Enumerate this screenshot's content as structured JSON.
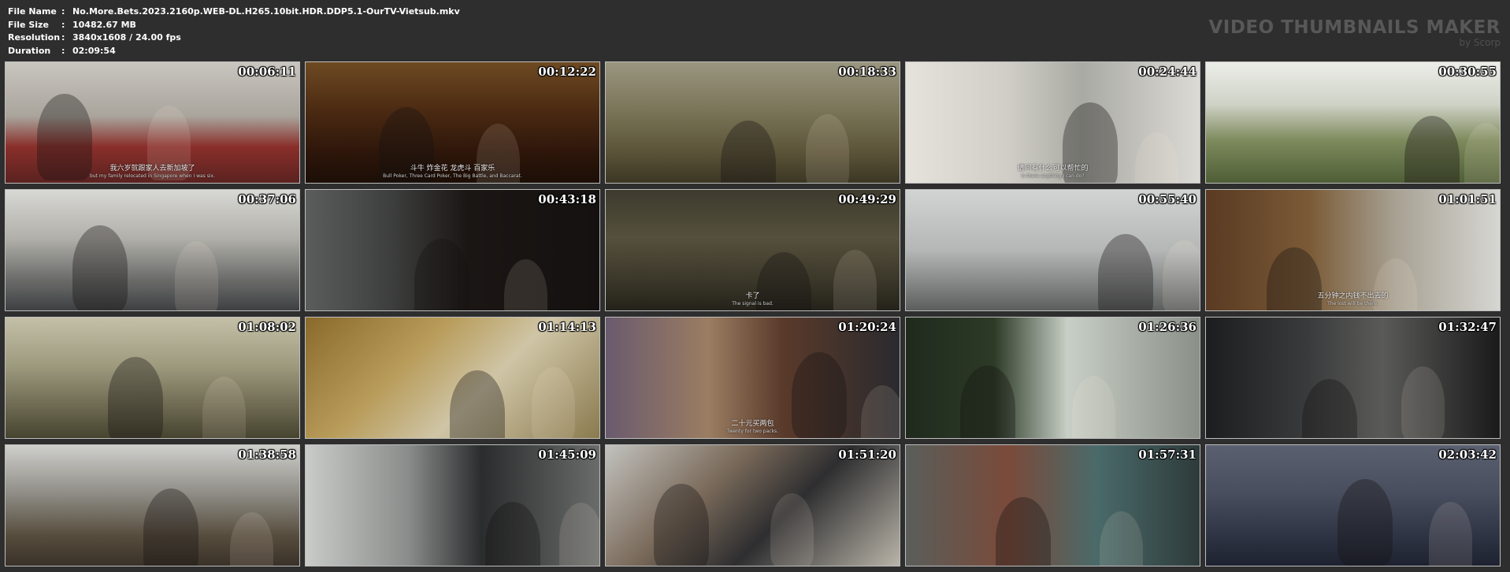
{
  "file_info": [
    {
      "label": "File Name",
      "sep": ":",
      "value": "No.More.Bets.2023.2160p.WEB-DL.H265.10bit.HDR.DDP5.1-OurTV-Vietsub.mkv"
    },
    {
      "label": "File Size",
      "sep": ":",
      "value": "10482.67 MB"
    },
    {
      "label": "Resolution",
      "sep": ":",
      "value": "3840x1608 / 24.00 fps"
    },
    {
      "label": "Duration",
      "sep": ":",
      "value": "02:09:54"
    }
  ],
  "brand": {
    "title": "VIDEO THUMBNAILS MAKER",
    "subtitle": "by Scorp"
  },
  "thumbnails": [
    {
      "time": "00:06:11",
      "sub_cn": "我六岁就跟家人去新加坡了",
      "sub_en": "but my family relocated in Singapore when I was six.",
      "bg": "linear-gradient(180deg,#c9c6bf 0%,#a9a49c 45%,#8a2f2a 70%,#5a2220 100%)"
    },
    {
      "time": "00:12:22",
      "sub_cn": "斗牛 炸金花 龙虎斗 百家乐",
      "sub_en": "Bull Poker, Three Card Poker, The Big Battle, and Baccarat.",
      "bg": "linear-gradient(180deg,#6e4a22 0%,#4b2a12 40%,#2d160a 75%,#1c0e06 100%)"
    },
    {
      "time": "00:18:33",
      "sub_cn": "",
      "sub_en": "",
      "bg": "linear-gradient(180deg,#9a9680 0%,#7a7558 40%,#5b5338 75%,#3b3624 100%)"
    },
    {
      "time": "00:24:44",
      "sub_cn": "请问有什么可以帮忙的",
      "sub_en": "Is there anything I can do?",
      "bg": "linear-gradient(90deg,#e6e3dc 0%,#cfcdc6 35%,#a9aaa3 60%,#dcdad5 100%)"
    },
    {
      "time": "00:30:55",
      "sub_cn": "",
      "sub_en": "",
      "bg": "linear-gradient(180deg,#eceee9 0%,#cfd2c6 35%,#7d8a5c 65%,#4f5e36 100%)"
    },
    {
      "time": "00:37:06",
      "sub_cn": "",
      "sub_en": "",
      "bg": "linear-gradient(180deg,#d8d8d4 0%,#b1b0aa 40%,#6a6b69 75%,#3f4042 100%)"
    },
    {
      "time": "00:43:18",
      "sub_cn": "",
      "sub_en": "",
      "bg": "linear-gradient(90deg,#5b5d5c 0%,#3c3d3c 30%,#1b1614 55%,#141110 100%)"
    },
    {
      "time": "00:49:29",
      "sub_cn": "卡了",
      "sub_en": "The signal is bad.",
      "bg": "linear-gradient(180deg,#3e3b2e 0%,#55503c 40%,#3b3729 75%,#24221a 100%)"
    },
    {
      "time": "00:55:40",
      "sub_cn": "",
      "sub_en": "",
      "bg": "linear-gradient(180deg,#d2d4d3 0%,#b5b7b6 50%,#7f8281 80%,#5b5e5d 100%)"
    },
    {
      "time": "01:01:51",
      "sub_cn": "五分钟之内钱不出去的",
      "sub_en": "The lost will be there.",
      "bg": "linear-gradient(90deg,#5a3a22 0%,#7a5a36 35%,#a8a294 65%,#d6d6d2 100%)"
    },
    {
      "time": "01:08:02",
      "sub_cn": "",
      "sub_en": "",
      "bg": "linear-gradient(180deg,#c4c0a8 0%,#9e9a7e 40%,#6c6850 75%,#46432f 100%)"
    },
    {
      "time": "01:14:13",
      "sub_cn": "",
      "sub_en": "",
      "bg": "linear-gradient(135deg,#8a6a2c 0%,#b89c5a 35%,#cfc5a6 60%,#8a7a4e 100%)"
    },
    {
      "time": "01:20:24",
      "sub_cn": "二十元买两包",
      "sub_en": "Twenty for two packs.",
      "bg": "linear-gradient(90deg,#6a5a6e 0%,#9b7d62 35%,#5a3a2a 60%,#2a2a2e 100%)"
    },
    {
      "time": "01:26:36",
      "sub_cn": "",
      "sub_en": "",
      "bg": "linear-gradient(90deg,#1f2a1d 0%,#2c3a26 30%,#c8cfc6 55%,#8a9088 100%)"
    },
    {
      "time": "01:32:47",
      "sub_cn": "",
      "sub_en": "",
      "bg": "linear-gradient(90deg,#1c1d1e 0%,#3a3b3c 35%,#5a5a58 60%,#1a1a1b 100%)"
    },
    {
      "time": "01:38:58",
      "sub_cn": "",
      "sub_en": "",
      "bg": "linear-gradient(180deg,#cfcfcc 0%,#8f8d86 40%,#574d3e 75%,#3a3128 100%)"
    },
    {
      "time": "01:45:09",
      "sub_cn": "",
      "sub_en": "",
      "bg": "linear-gradient(90deg,#c9cbc9 0%,#8a8c8b 35%,#2a2c2d 60%,#6a6c6b 100%)"
    },
    {
      "time": "01:51:20",
      "sub_cn": "",
      "sub_en": "",
      "bg": "linear-gradient(135deg,#c2c2be 0%,#7a6a5a 35%,#2e2e30 60%,#b9b4a8 100%)"
    },
    {
      "time": "01:57:31",
      "sub_cn": "",
      "sub_en": "",
      "bg": "linear-gradient(90deg,#5a5e5a 0%,#7a4a3a 35%,#4a6a6a 65%,#2e3a3a 100%)"
    },
    {
      "time": "02:03:42",
      "sub_cn": "",
      "sub_en": "",
      "bg": "linear-gradient(180deg,#5a6070 0%,#484e5e 40%,#2e3444 75%,#1e2230 100%)"
    }
  ]
}
